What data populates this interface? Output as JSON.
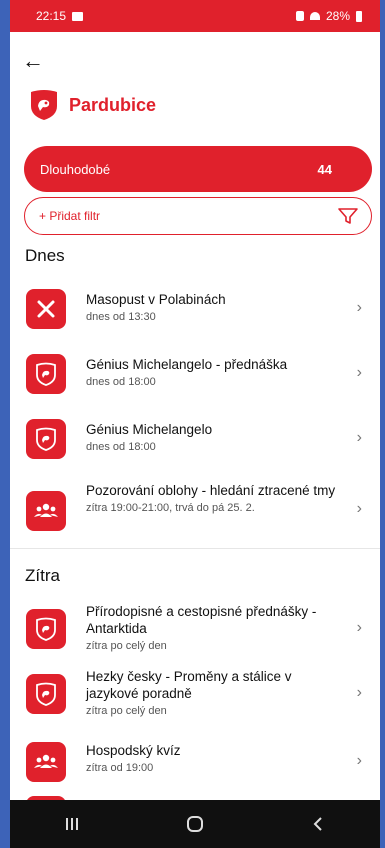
{
  "status": {
    "time": "22:15",
    "battery": "28%"
  },
  "brand": {
    "name": "Pardubice"
  },
  "filters": {
    "category_label": "Dlouhodobé",
    "category_count": "44",
    "add_filter_label": "+ Přidat filtr"
  },
  "sections": [
    {
      "title": "Dnes",
      "items": [
        {
          "icon": "cross-icon",
          "title": "Masopust v Polabinách",
          "subtitle": "dnes od 13:30"
        },
        {
          "icon": "city-logo-icon",
          "title": "Génius Michelangelo - přednáška",
          "subtitle": "dnes od 18:00"
        },
        {
          "icon": "city-logo-icon",
          "title": "Génius Michelangelo",
          "subtitle": "dnes od 18:00"
        },
        {
          "icon": "group-icon",
          "title": "Pozorování oblohy - hledání ztracené tmy",
          "subtitle": "zítra 19:00-21:00, trvá do pá 25. 2."
        }
      ]
    },
    {
      "title": "Zítra",
      "items": [
        {
          "icon": "city-logo-icon",
          "title": "Přírodopisné a cestopisné přednášky - Antarktida",
          "subtitle": "zítra po celý den"
        },
        {
          "icon": "city-logo-icon",
          "title": "Hezky česky - Proměny a stálice v jazykové poradně",
          "subtitle": "zítra po celý den"
        },
        {
          "icon": "group-icon",
          "title": "Hospodský kvíz",
          "subtitle": "zítra od 19:00"
        }
      ]
    }
  ],
  "colors": {
    "accent": "#e0212c"
  }
}
